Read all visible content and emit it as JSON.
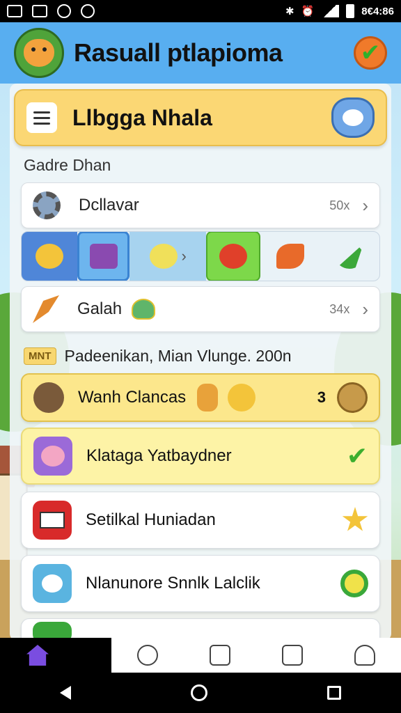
{
  "status_bar": {
    "time": "8€4:86"
  },
  "app": {
    "title": "Rasuall ptlapioma"
  },
  "title_card": {
    "title": "Llbgga Nhala"
  },
  "section": {
    "label": "Gadre Dhan"
  },
  "rows": [
    {
      "label": "Dcllavar",
      "value": "50x"
    },
    {
      "label": "Galah",
      "value": "34x"
    }
  ],
  "promo": {
    "tag": "MNT",
    "text": "Padeenikan, Mian Vlunge. 200n"
  },
  "cards": [
    {
      "label": "Wanh Clancas",
      "count": "3"
    },
    {
      "label": "Klataga Yatbaydner"
    },
    {
      "label": "Setilkal Huniadan"
    },
    {
      "label": "Nlanunore Snnlk Lalclik"
    }
  ],
  "colors": {
    "header_blue": "#58aef0",
    "title_yellow": "#fbd774",
    "accent_green": "#3cae2e",
    "nav_active": "#7a4de0"
  }
}
